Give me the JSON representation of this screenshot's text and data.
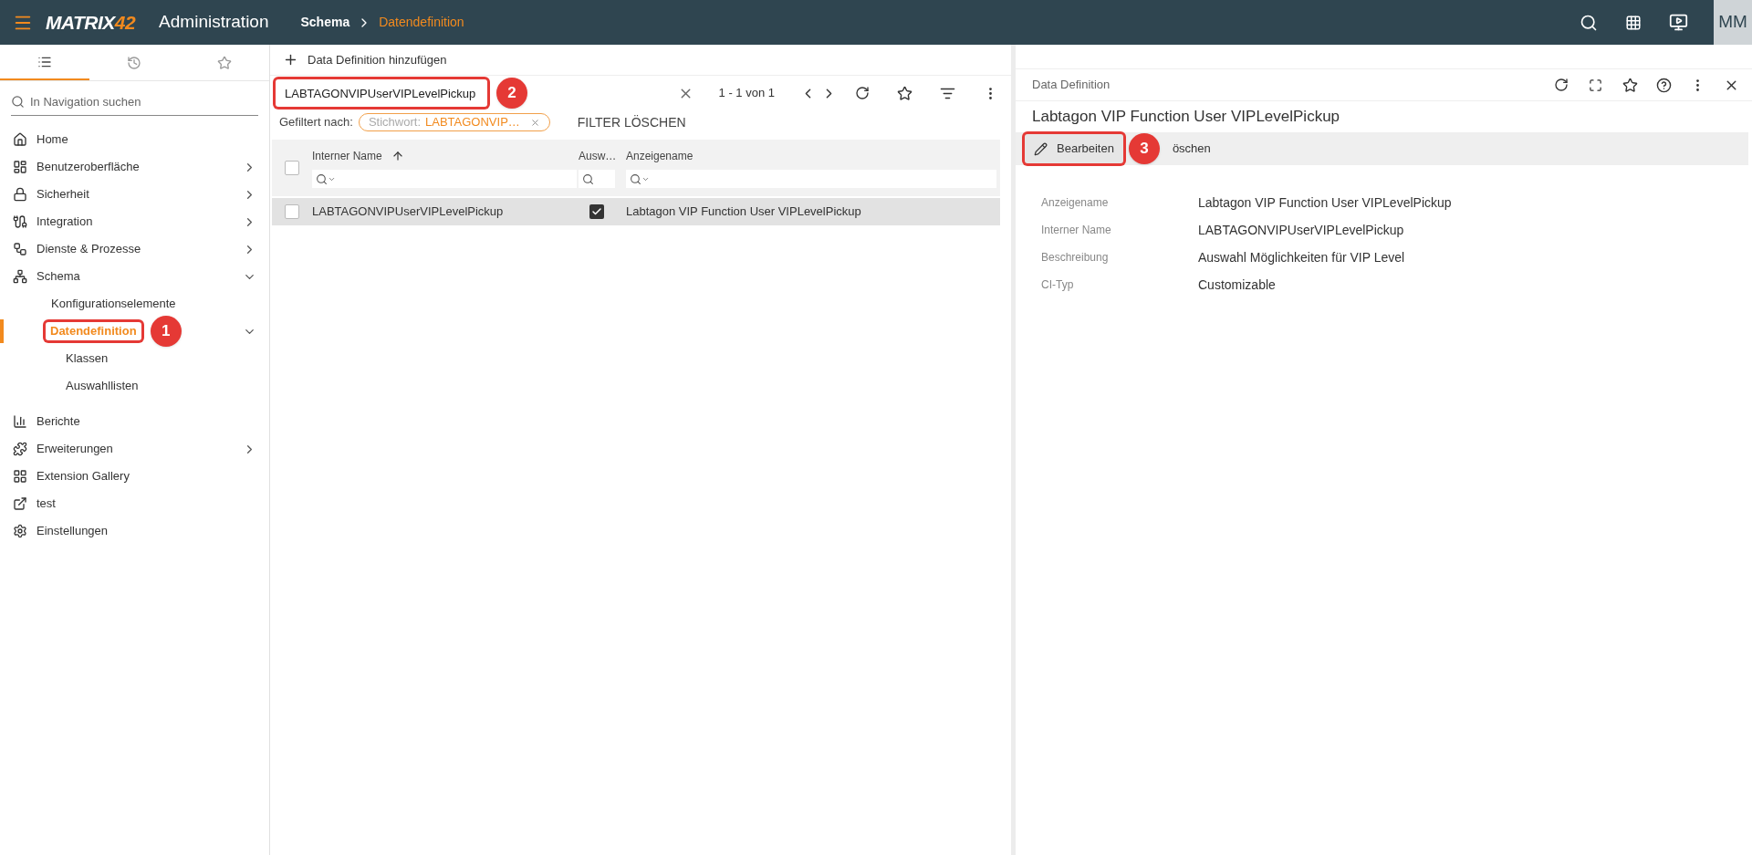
{
  "header": {
    "logo": {
      "text": "MATRIX",
      "accent": "42"
    },
    "app_name": "Administration",
    "breadcrumb": [
      {
        "label": "Schema",
        "current": false
      },
      {
        "label": "Datendefinition",
        "current": true
      }
    ],
    "avatar": "MM"
  },
  "sidebar": {
    "tabs": [
      {
        "selected": true
      },
      {
        "selected": false
      },
      {
        "selected": false
      }
    ],
    "search": {
      "placeholder": "In Navigation suchen"
    },
    "items": [
      {
        "kind": "link",
        "label": "Home",
        "selected": false
      },
      {
        "kind": "group",
        "label": "Benutzeroberfläche",
        "expanded": false,
        "selected": false
      },
      {
        "kind": "group",
        "label": "Sicherheit",
        "expanded": false,
        "selected": false
      },
      {
        "kind": "group",
        "label": "Integration",
        "expanded": false,
        "selected": false
      },
      {
        "kind": "group",
        "label": "Dienste & Prozesse",
        "expanded": false,
        "selected": false
      },
      {
        "kind": "group",
        "label": "Schema",
        "expanded": true,
        "selected": false,
        "children": [
          {
            "kind": "link",
            "label": "Konfigurationselemente",
            "selected": false
          },
          {
            "kind": "group",
            "label": "Datendefinition",
            "expanded": true,
            "selected": true,
            "marker": "1",
            "children": [
              {
                "kind": "link",
                "label": "Klassen",
                "selected": false
              },
              {
                "kind": "link",
                "label": "Auswahllisten",
                "selected": false
              }
            ]
          }
        ]
      },
      {
        "kind": "link",
        "label": "Berichte",
        "selected": false
      },
      {
        "kind": "group",
        "label": "Erweiterungen",
        "expanded": false,
        "selected": false
      },
      {
        "kind": "link",
        "label": "Extension Gallery",
        "selected": false
      },
      {
        "kind": "link",
        "label": "test",
        "selected": false
      },
      {
        "kind": "link",
        "label": "Einstellungen",
        "selected": false
      }
    ]
  },
  "list_panel": {
    "add_button": "Data Definition hinzufügen",
    "search": {
      "value": "LABTAGONVIPUserVIPLevelPickup",
      "marker": "2"
    },
    "pagination": "1 - 1 von 1",
    "filter": {
      "label": "Gefiltert nach:",
      "chip_key": "Stichwort:",
      "chip_value": "LABTAGONVIP…",
      "clear": "FILTER LÖSCHEN"
    },
    "table": {
      "all_checked": false,
      "columns": [
        {
          "label": "Interner Name",
          "sorted": true
        },
        {
          "label": "Ausw…",
          "sorted": false
        },
        {
          "label": "Anzeigename",
          "sorted": false
        }
      ],
      "rows": [
        {
          "highlighted": true,
          "checked": false,
          "internal_name": "LABTAGONVIPUserVIPLevelPickup",
          "selection": true,
          "display_name": "Labtagon VIP Function User VIPLevelPickup"
        }
      ]
    }
  },
  "detail_panel": {
    "title": "Data Definition",
    "heading": "Labtagon VIP Function User VIPLevelPickup",
    "actions": [
      {
        "label": "Bearbeiten",
        "marker": "3"
      },
      {
        "label": "öschen"
      }
    ],
    "fields": [
      {
        "label": "Anzeigename",
        "value": "Labtagon VIP Function User VIPLevelPickup"
      },
      {
        "label": "Interner Name",
        "value": "LABTAGONVIPUserVIPLevelPickup"
      },
      {
        "label": "Beschreibung",
        "value": "Auswahl Möglichkeiten für VIP Level"
      },
      {
        "label": "CI-Typ",
        "value": "Customizable"
      }
    ]
  }
}
